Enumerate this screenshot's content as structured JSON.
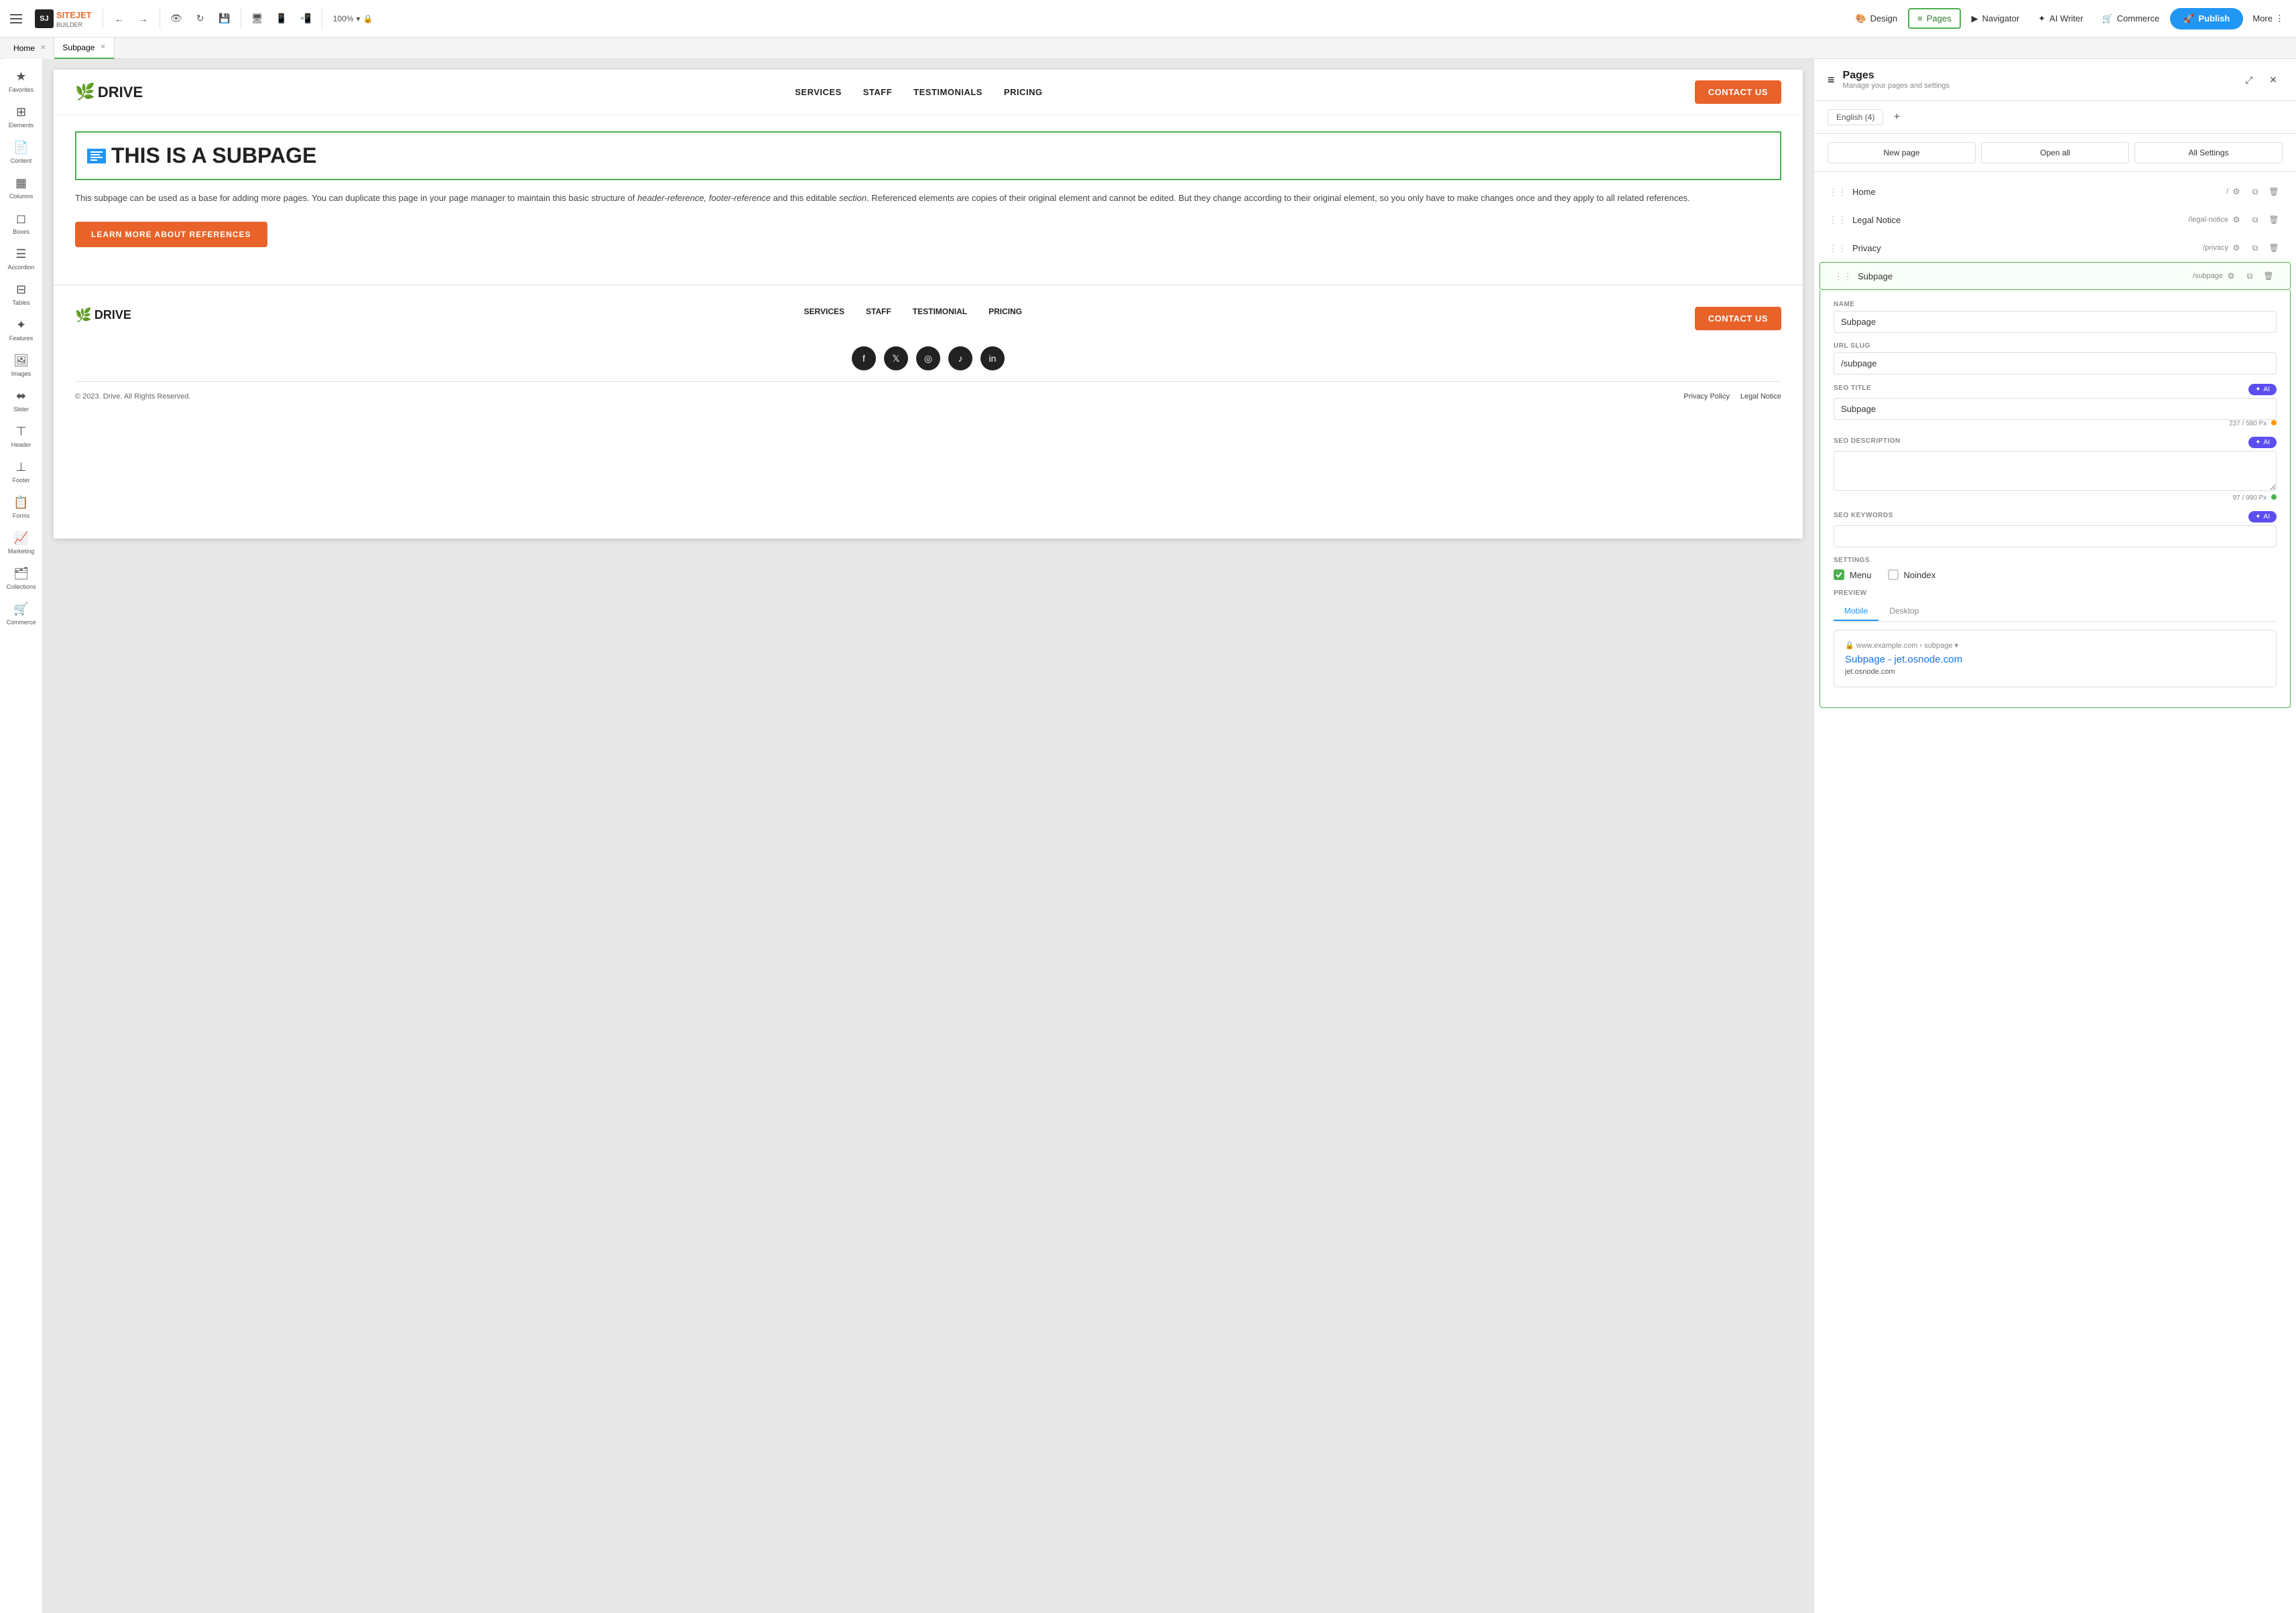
{
  "topbar": {
    "logo_text": "SITEJET",
    "logo_sub": "BUILDER",
    "tabs": [
      {
        "label": "Home",
        "active": false,
        "closeable": true
      },
      {
        "label": "Subpage",
        "active": true,
        "closeable": true
      }
    ],
    "zoom": "100%",
    "design_label": "Design",
    "pages_label": "Pages",
    "navigator_label": "Navigator",
    "ai_writer_label": "AI Writer",
    "commerce_label": "Commerce",
    "publish_label": "Publish",
    "more_label": "More"
  },
  "sidebar": {
    "items": [
      {
        "id": "favorites",
        "icon": "★",
        "label": "Favorites"
      },
      {
        "id": "elements",
        "icon": "⊞",
        "label": "Elements"
      },
      {
        "id": "content",
        "icon": "📄",
        "label": "Content"
      },
      {
        "id": "columns",
        "icon": "▦",
        "label": "Columns"
      },
      {
        "id": "boxes",
        "icon": "◻",
        "label": "Boxes"
      },
      {
        "id": "accordion",
        "icon": "☰",
        "label": "Accordion"
      },
      {
        "id": "tables",
        "icon": "⊟",
        "label": "Tables"
      },
      {
        "id": "features",
        "icon": "✦",
        "label": "Features"
      },
      {
        "id": "images",
        "icon": "🖼",
        "label": "Images"
      },
      {
        "id": "slider",
        "icon": "⬌",
        "label": "Slider"
      },
      {
        "id": "header",
        "icon": "⊤",
        "label": "Header"
      },
      {
        "id": "footer",
        "icon": "⊥",
        "label": "Footer"
      },
      {
        "id": "forms",
        "icon": "📋",
        "label": "Forms"
      },
      {
        "id": "marketing",
        "icon": "📈",
        "label": "Marketing"
      },
      {
        "id": "collections",
        "icon": "🗂",
        "label": "Collections"
      },
      {
        "id": "commerce",
        "icon": "🛒",
        "label": "Commerce"
      }
    ]
  },
  "website": {
    "logo": "DRIVE",
    "nav_items": [
      "SERVICES",
      "STAFF",
      "TESTIMONIALS",
      "PRICING"
    ],
    "contact_btn": "CONTACT US",
    "page_title": "THIS IS A SUBPAGE",
    "page_desc_1": "This subpage can be used as a base for adding more pages. You can duplicate this page in your page manager to maintain this basic structure of ",
    "page_desc_italic_1": "header-reference, footer-reference",
    "page_desc_2": " and this editable ",
    "page_desc_italic_2": "section",
    "page_desc_3": ". Referenced elements are copies of their original element and cannot be edited. But they change according to their original element, so you only have to make changes once and they apply to all related references.",
    "learn_more_btn": "LEARN MORE ABOUT REFERENCES",
    "footer_logo": "DRIVE",
    "footer_nav": [
      "SERVICES",
      "STAFF",
      "TESTIMONIAL",
      "PRICING"
    ],
    "footer_contact": "CONTACT US",
    "social_icons": [
      "f",
      "t",
      "in",
      "♪",
      "li"
    ],
    "copyright": "© 2023. Drive. All Rights Reserved.",
    "footer_links": [
      "Privacy Policy",
      "Legal Notice"
    ]
  },
  "panel": {
    "title": "Pages",
    "subtitle": "Manage your pages and settings",
    "language_tab": "English (4)",
    "new_page_btn": "New page",
    "open_all_btn": "Open all",
    "all_settings_btn": "All Settings",
    "pages": [
      {
        "name": "Home",
        "slug": "/",
        "active": false
      },
      {
        "name": "Legal Notice",
        "slug": "/legal-notice",
        "active": false
      },
      {
        "name": "Privacy",
        "slug": "/privacy",
        "active": false
      },
      {
        "name": "Subpage",
        "slug": "/subpage",
        "active": true
      }
    ],
    "form": {
      "name_label": "NAME",
      "name_value": "Subpage",
      "url_slug_label": "URL SLUG",
      "url_slug_value": "/subpage",
      "seo_title_label": "SEO TITLE",
      "seo_title_value": "Subpage",
      "seo_title_chars": "237 / 580 Px",
      "seo_desc_label": "SEO DESCRIPTION",
      "seo_desc_chars": "97 / 990 Px",
      "seo_keywords_label": "SEO KEYWORDS",
      "settings_label": "SETTINGS",
      "menu_label": "Menu",
      "noindex_label": "Noindex",
      "preview_label": "PREVIEW",
      "preview_mobile_tab": "Mobile",
      "preview_desktop_tab": "Desktop",
      "preview_url": "www.example.com › subpage",
      "preview_title": "Subpage - jet.osnode.com",
      "preview_desc": "jet.osnode.com",
      "ai_label": "AI"
    }
  }
}
